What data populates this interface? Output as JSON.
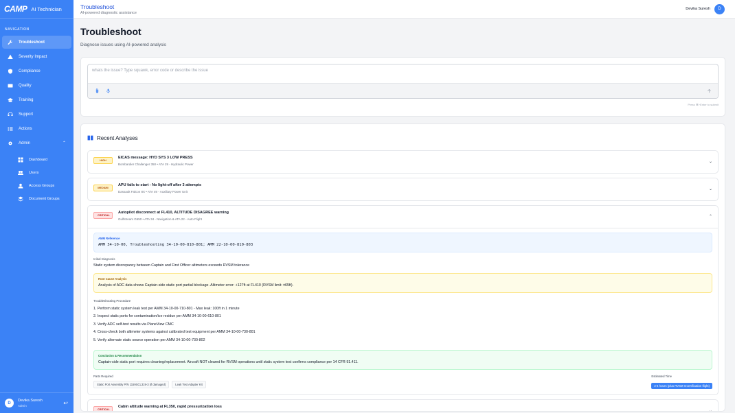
{
  "brand": {
    "logo": "CAMP",
    "name": "AI Technician"
  },
  "sidebar": {
    "section_title": "NAVIGATION",
    "items": [
      {
        "label": "Troubleshoot",
        "icon": "wrench-icon"
      },
      {
        "label": "Severity Impact",
        "icon": "warning-icon"
      },
      {
        "label": "Compliance",
        "icon": "shield-icon"
      },
      {
        "label": "Quality",
        "icon": "chart-icon"
      },
      {
        "label": "Training",
        "icon": "graduation-icon"
      },
      {
        "label": "Support",
        "icon": "headset-icon"
      },
      {
        "label": "Actions",
        "icon": "checklist-icon"
      },
      {
        "label": "Admin",
        "icon": "gear-icon"
      }
    ],
    "admin_sub": [
      {
        "label": "Dashboard",
        "icon": "grid-icon"
      },
      {
        "label": "Users",
        "icon": "users-icon"
      },
      {
        "label": "Access Groups",
        "icon": "user-group-icon"
      },
      {
        "label": "Document Groups",
        "icon": "document-group-icon"
      }
    ],
    "user": {
      "initial": "D",
      "name": "Devika Suresh",
      "role": "Admin"
    }
  },
  "header": {
    "title": "Troubleshoot",
    "subtitle": "AI-powered diagnostic assistance",
    "user_name": "Devika Suresh",
    "user_initial": "D"
  },
  "page": {
    "title": "Troubleshoot",
    "subtitle": "Diagnose issues using AI-powered analysis"
  },
  "query": {
    "placeholder": "whats the issue? Type squawk, error code or describe the issue",
    "hint": "Press ⌘+Enter to submit"
  },
  "recent": {
    "title": "Recent Analyses",
    "items": [
      {
        "severity": "HIGH",
        "title": "EICAS message: HYD SYS 3 LOW PRESS",
        "meta": "Bombardier Challenger 350 • ATA 29 - Hydraulic Power"
      },
      {
        "severity": "MEDIUM",
        "title": "APU fails to start - No light-off after 3 attempts",
        "meta": "Dassault Falcon 8X • ATA 49 - Auxiliary Power Unit"
      },
      {
        "severity": "CRITICAL",
        "title": "Autopilot disconnect at FL410, ALTITUDE DISAGREE warning",
        "meta": "Gulfstream G650 • ATA 34 - Navigation & ATA 22 - Auto Flight"
      },
      {
        "severity": "CRITICAL",
        "title": "Cabin altitude warning at FL350, rapid pressurization loss",
        "meta": ""
      }
    ],
    "expanded": {
      "amm_label": "AMM Reference",
      "amm_value": "AMM 34-10-00, Troubleshooting 34-10-00-810-801; AMM 22-10-00-810-803",
      "diagnosis_label": "Initial Diagnosis",
      "diagnosis_text": "Static system discrepancy between Captain and First Officer altimeters exceeds RVSM tolerance",
      "rca_label": "Root Cause Analysis",
      "rca_text": "Analysis of ADC data shows Captain-side static port partial blockage. Altimeter error: +127ft at FL410 (RVSM limit: ±65ft).",
      "steps_label": "Troubleshooting Procedure",
      "steps": [
        "1. Perform static system leak test per AMM 34-10-00-710-801 - Max leak: 100ft in 1 minute",
        "2. Inspect static ports for contamination/ice residue per AMM 34-10-00-610-801",
        "3. Verify ADC self-test results via PlaneView CMC",
        "4. Cross-check both altimeter systems against calibrated test equipment per AMM 34-10-00-730-801",
        "5. Verify alternate static source operation per AMM 34-10-00-730-802"
      ],
      "conclusion_label": "Conclusion & Recommendation",
      "conclusion_text": "Captain-side static port requires cleaning/replacement. Aircraft NOT cleared for RVSM operations until static system test confirms compliance per 14 CFR 91.411.",
      "parts_label": "Parts Required",
      "parts": [
        "Static Port Assembly P/N 1159SCL319-3 (if damaged)",
        "Leak Test Adapter Kit"
      ],
      "time_label": "Estimated Time",
      "time_value": "2-4 hours (plus RVSM recertification flight)"
    }
  },
  "colors": {
    "accent": "#3b82f6",
    "sidebar": "#3b82f6",
    "critical": "#b91c1c",
    "high": "#b45309"
  }
}
